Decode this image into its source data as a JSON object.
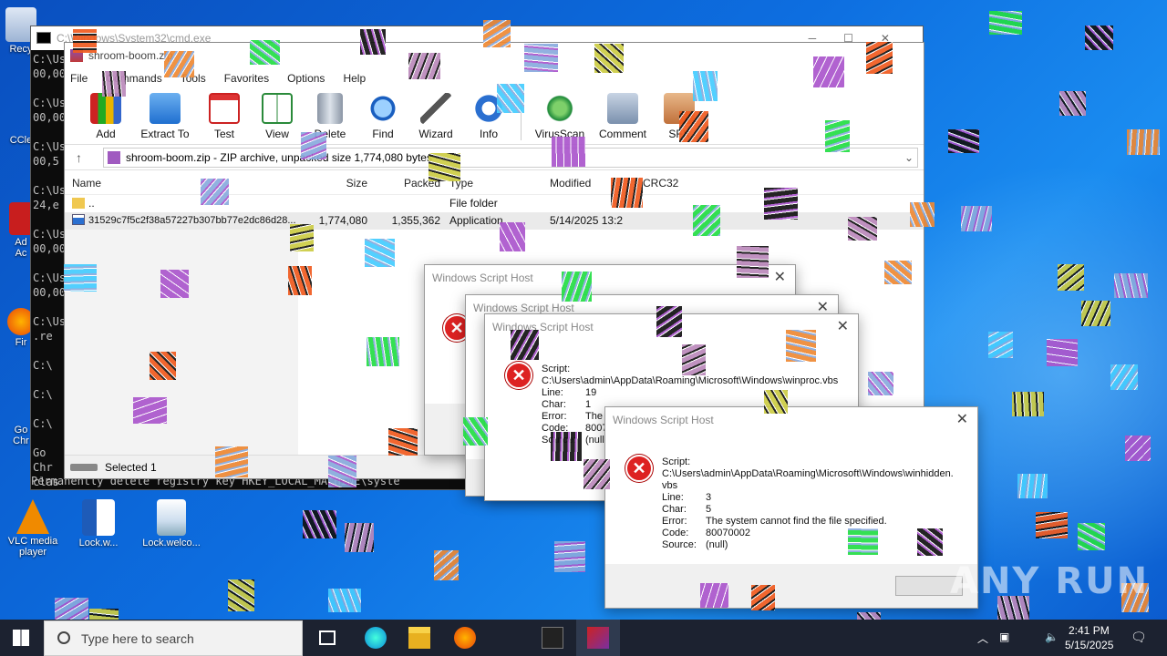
{
  "desktop": {
    "icons": [
      {
        "label": "Recy"
      },
      {
        "label": "CCle"
      },
      {
        "label": "Ad\nAc"
      },
      {
        "label": "Fir"
      },
      {
        "label": "Go\nChr"
      },
      {
        "label": "VLC media\nplayer"
      },
      {
        "label": "Lock.w..."
      },
      {
        "label": "Lock.welco..."
      }
    ]
  },
  "cmd": {
    "title": "C:\\Windows\\System32\\cmd.exe",
    "lines": [
      "C:\\Us",
      "00,00",
      "",
      "C:\\Us",
      "00,00",
      "",
      "C:\\Us",
      "00,5",
      "",
      "C:\\Us",
      "24,e",
      "",
      "C:\\Us",
      "00,00",
      "",
      "C:\\Us",
      "00,00",
      "",
      "C:\\Us",
      ".re",
      "",
      "C:\\",
      "",
      "C:\\",
      "",
      "C:\\",
      "",
      "Go",
      "Chr",
      "clas"
    ],
    "bottom_line": "Permanently delete registry key HKEY_LOCAL_MACHINE\\syste"
  },
  "winrar": {
    "title": "shroom-boom.zip",
    "menu": [
      "File",
      "Commands",
      "Tools",
      "Favorites",
      "Options",
      "Help"
    ],
    "toolbar": [
      {
        "label": "Add",
        "icon": "books-icon"
      },
      {
        "label": "Extract To",
        "icon": "folder-icon"
      },
      {
        "label": "Test",
        "icon": "clipboard-icon"
      },
      {
        "label": "View",
        "icon": "book-icon"
      },
      {
        "label": "Delete",
        "icon": "trash-icon"
      },
      {
        "label": "Find",
        "icon": "magnifier-icon"
      },
      {
        "label": "Wizard",
        "icon": "wand-icon"
      },
      {
        "label": "Info",
        "icon": "info-icon"
      },
      {
        "label": "VirusScan",
        "icon": "globe-icon"
      },
      {
        "label": "Comment",
        "icon": "comment-icon"
      },
      {
        "label": "SFX",
        "icon": "box-icon"
      }
    ],
    "address": "shroom-boom.zip - ZIP archive, unpacked size 1,774,080 bytes",
    "columns": [
      "Name",
      "Size",
      "Packed",
      "Type",
      "Modified",
      "CRC32"
    ],
    "rows": [
      {
        "name": "..",
        "size": "",
        "packed": "",
        "type": "File folder",
        "modified": "",
        "crc": ""
      },
      {
        "name": "31529c7f5c2f38a57227b307bb77e2dc86d28...",
        "size": "1,774,080",
        "packed": "1,355,362",
        "type": "Application",
        "modified": "5/14/2025 13:2",
        "crc": ""
      }
    ],
    "status": "Selected 1"
  },
  "dialogs": {
    "title": "Windows Script Host",
    "d3": {
      "script_label": "Script:",
      "script_path": "C:\\Users\\admin\\AppData\\Roaming\\Microsoft\\Windows\\winproc.vbs",
      "line_label": "Line:",
      "line": "19",
      "char_label": "Char:",
      "char": "1",
      "error_label": "Error:",
      "error": "The",
      "code_label": "Code:",
      "code": "8007",
      "source_label": "Source:",
      "source": "(null"
    },
    "d4": {
      "script_label": "Script:",
      "script_path": "C:\\Users\\admin\\AppData\\Roaming\\Microsoft\\Windows\\winhidden.vbs",
      "line_label": "Line:",
      "line": "3",
      "char_label": "Char:",
      "char": "5",
      "error_label": "Error:",
      "error": "The system cannot find the file specified.",
      "code_label": "Code:",
      "code": "80070002",
      "source_label": "Source:",
      "source": "(null)"
    }
  },
  "taskbar": {
    "search_placeholder": "Type here to search",
    "time": "2:41 PM",
    "date": "5/15/2025"
  },
  "watermark": "ANY RUN",
  "colors": {
    "accent": "#0a6fdc",
    "error": "#d22222",
    "glitch_orange": "#f05a1e",
    "glitch_green": "#22dd44"
  }
}
